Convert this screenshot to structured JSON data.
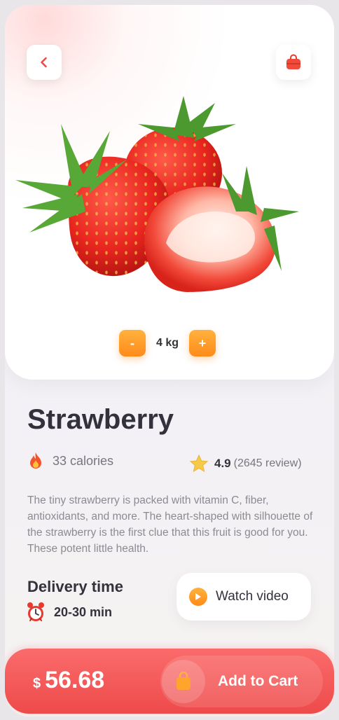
{
  "header": {
    "back_icon": "chevron-left-icon",
    "cart_icon": "shopping-bag-icon"
  },
  "product": {
    "name": "Strawberry",
    "quantity": {
      "minus_label": "-",
      "value": "4 kg",
      "plus_label": "+"
    },
    "calories": "33 calories",
    "rating": "4.9",
    "reviews": "(2645 review)",
    "description": "The tiny strawberry is packed with vitamin C, fiber, antioxidants, and more. The heart-shaped with silhouette of the strawberry is the first clue that this fruit is good for you. These potent little health."
  },
  "delivery": {
    "title": "Delivery time",
    "time": "20-30 min"
  },
  "watch": {
    "label": "Watch video"
  },
  "cart": {
    "currency": "$",
    "price": "56.68",
    "add_label": "Add to Cart"
  },
  "colors": {
    "accent_red": "#ee4a4a",
    "accent_orange": "#ff9a2a",
    "text_dark": "#33323c",
    "text_muted": "#8c8a93"
  }
}
